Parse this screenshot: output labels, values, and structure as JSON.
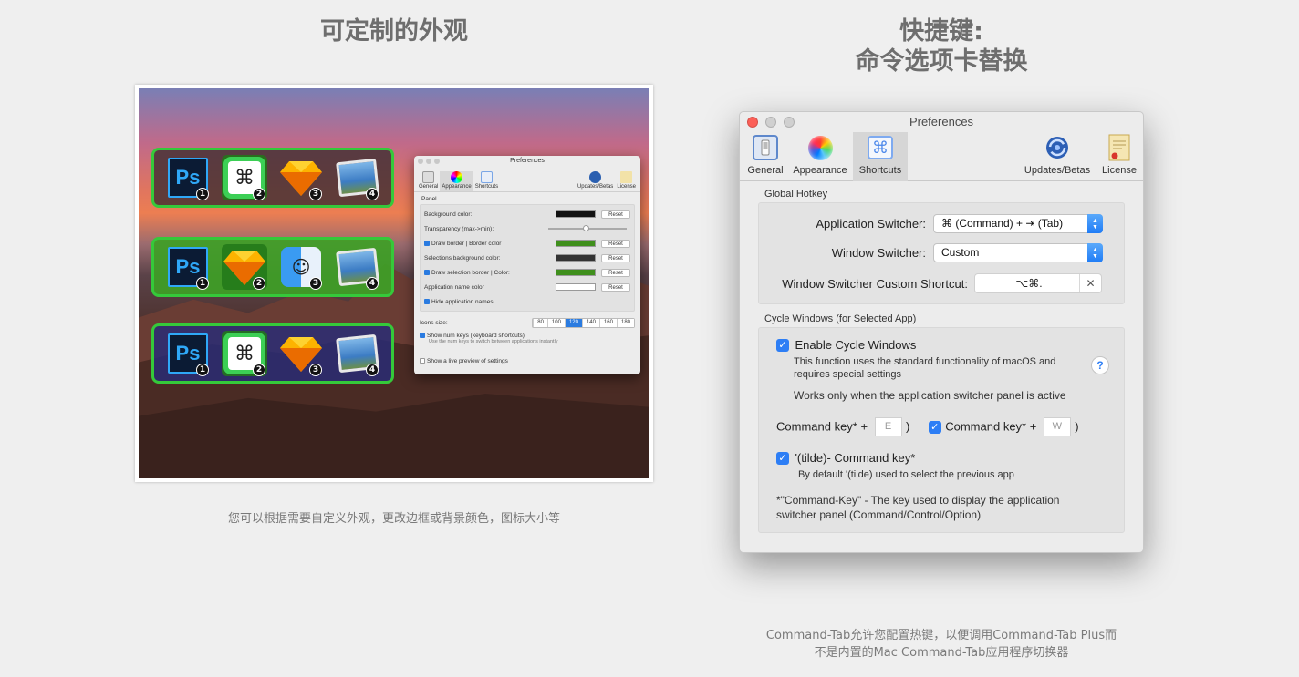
{
  "left": {
    "heading": "可定制的外观",
    "caption": "您可以根据需要自定义外观，更改边框或背景颜色，图标大小等",
    "switcher_badges": [
      "1",
      "2",
      "3",
      "4"
    ],
    "mini_prefs": {
      "title": "Preferences",
      "tabs": [
        "General",
        "Appearance",
        "Shortcuts",
        "Updates/Betas",
        "License"
      ],
      "panel_label": "Panel",
      "rows": [
        {
          "label": "Background color:",
          "reset": "Reset",
          "color": "#111111"
        },
        {
          "label": "Transparency (max->min):"
        },
        {
          "label": "Draw border | Border color",
          "reset": "Reset",
          "color": "#3f8f1c"
        },
        {
          "label": "Selections background color:",
          "reset": "Reset",
          "color": "#333333"
        },
        {
          "label": "Draw selection border | Color:",
          "reset": "Reset",
          "color": "#3f8f1c"
        },
        {
          "label": "Application name color",
          "reset": "Reset",
          "color": "#ffffff"
        },
        {
          "label": "Hide application names"
        }
      ],
      "icons_size_label": "Icons size:",
      "icon_sizes": [
        "80",
        "100",
        "120",
        "140",
        "160",
        "180"
      ],
      "selected_size": "120",
      "num_keys_label": "Show num keys (keyboard shortcuts)",
      "num_keys_hint": "Use the num keys to switch between applications instantly",
      "live_preview_label": "Show a live preview of settings"
    }
  },
  "right": {
    "heading_line1": "快捷键:",
    "heading_line2": "命令选项卡替换",
    "caption_line1": "Command-Tab允许您配置热键，以便调用Command-Tab Plus而",
    "caption_line2": "不是内置的Mac Command-Tab应用程序切换器",
    "window": {
      "title": "Preferences",
      "tabs": {
        "general": "General",
        "appearance": "Appearance",
        "shortcuts": "Shortcuts",
        "updates": "Updates/Betas",
        "license": "License"
      },
      "global_hotkey": {
        "title": "Global Hotkey",
        "app_switcher_label": "Application Switcher:",
        "app_switcher_value": "⌘ (Command) + ⇥ (Tab)",
        "window_switcher_label": "Window Switcher:",
        "window_switcher_value": "Custom",
        "custom_shortcut_label": "Window Switcher Custom Shortcut:",
        "custom_shortcut_value": "⌥⌘.",
        "clear_icon": "✕"
      },
      "cycle": {
        "title": "Cycle Windows (for Selected App)",
        "enable_label": "Enable Cycle Windows",
        "desc_line1": "This function uses the standard functionality of macOS and",
        "desc_line2": "requires special settings",
        "works_only": "Works only when the application switcher panel is active",
        "help": "?",
        "cmd_key_label_1": "Command key* +",
        "key_1": "E",
        "paren_close": ")",
        "cmd_key_label_2": "Command key* +",
        "key_2": "W",
        "tilde_label": "'(tilde)- Command key*",
        "tilde_hint": "By default '(tilde) used to select the previous app",
        "footnote_line1": "*\"Command-Key\" - The key used to display the application",
        "footnote_line2": "switcher panel (Command/Control/Option)"
      }
    }
  }
}
